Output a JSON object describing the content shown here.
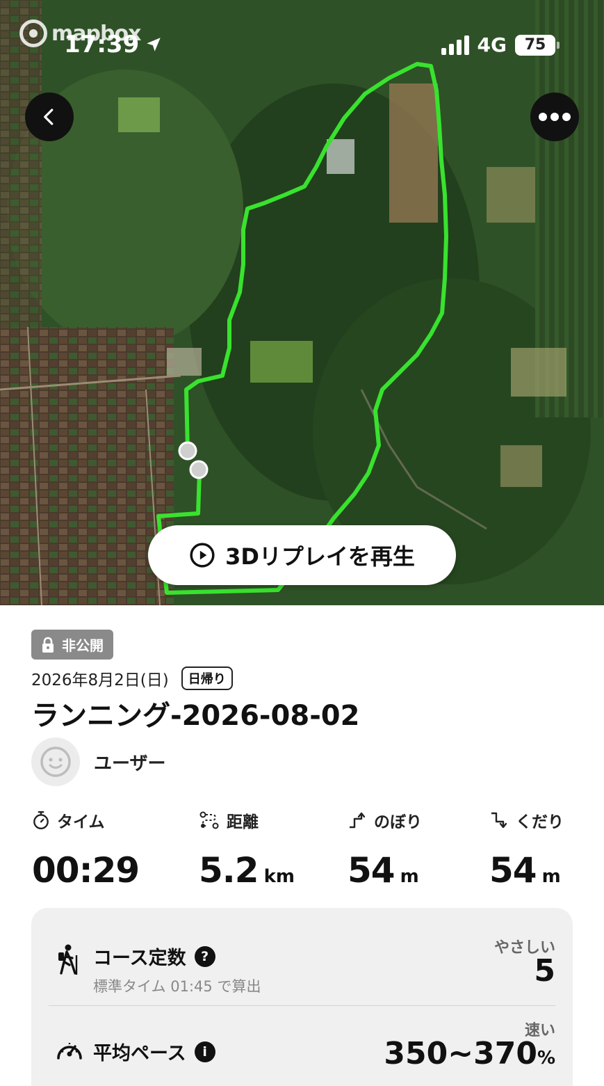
{
  "map": {
    "attribution": "mapbox",
    "replay_button_label": "3Dリプレイを再生",
    "route_color": "#39e22e"
  },
  "status_bar": {
    "time": "17:39",
    "network": "4G",
    "battery": "75"
  },
  "header": {
    "back_icon": "chevron-left-icon",
    "more_icon": "more-dots-icon"
  },
  "activity": {
    "privacy": "非公開",
    "date": "2026年8月2日(日)",
    "trip_type": "日帰り",
    "title": "ランニング-2026-08-02",
    "user_name": "ユーザー"
  },
  "stats": {
    "time": {
      "label": "タイム",
      "value": "00:29",
      "unit": ""
    },
    "distance": {
      "label": "距離",
      "value": "5.2",
      "unit": "km"
    },
    "ascent": {
      "label": "のぼり",
      "value": "54",
      "unit": "m"
    },
    "descent": {
      "label": "くだり",
      "value": "54",
      "unit": "m"
    }
  },
  "summary": {
    "course": {
      "title": "コース定数",
      "help": "?",
      "sub": "標準タイム 01:45 で算出",
      "rating_label": "やさしい",
      "rating_value": "5"
    },
    "pace": {
      "title": "平均ペース",
      "help": "i",
      "rating_label": "速い",
      "rating_value": "350~370",
      "rating_unit": "%"
    }
  }
}
